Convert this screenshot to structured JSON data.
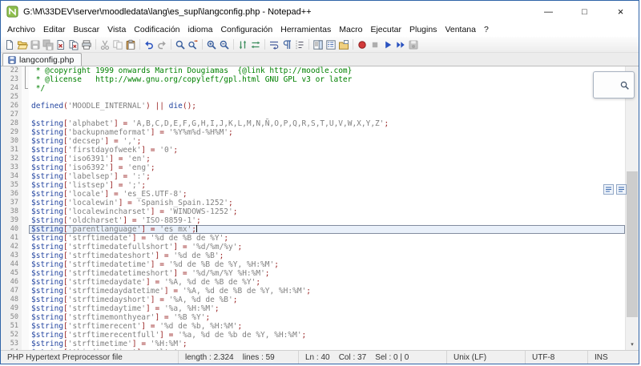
{
  "window": {
    "title": "G:\\M\\33DEV\\server\\moodledata\\lang\\es_supl\\langconfig.php - Notepad++",
    "controls": {
      "minimize": "—",
      "maximize": "□",
      "close": "×"
    }
  },
  "icons": {
    "scroll_up": "▴",
    "scroll_down": "▾"
  },
  "menu": {
    "items": [
      {
        "label": "Archivo",
        "name": "archivo"
      },
      {
        "label": "Editar",
        "name": "editar"
      },
      {
        "label": "Buscar",
        "name": "buscar"
      },
      {
        "label": "Vista",
        "name": "vista"
      },
      {
        "label": "Codificación",
        "name": "codificacion"
      },
      {
        "label": "idioma",
        "name": "idioma"
      },
      {
        "label": "Configuración",
        "name": "configuracion"
      },
      {
        "label": "Herramientas",
        "name": "herramientas"
      },
      {
        "label": "Macro",
        "name": "macro"
      },
      {
        "label": "Ejecutar",
        "name": "ejecutar"
      },
      {
        "label": "Plugins",
        "name": "plugins"
      },
      {
        "label": "Ventana",
        "name": "ventana"
      },
      {
        "label": "?",
        "name": "help"
      }
    ]
  },
  "toolbar": {
    "items": [
      {
        "name": "new-file",
        "icon": "new"
      },
      {
        "name": "open-file",
        "icon": "open"
      },
      {
        "name": "save-file",
        "icon": "save",
        "disabled": true
      },
      {
        "name": "save-all",
        "icon": "saveall",
        "disabled": true
      },
      {
        "name": "close-file",
        "icon": "close"
      },
      {
        "name": "close-all",
        "icon": "closeall"
      },
      {
        "name": "print",
        "icon": "print"
      },
      {
        "sep": true
      },
      {
        "name": "cut",
        "icon": "cut",
        "disabled": true
      },
      {
        "name": "copy",
        "icon": "copy",
        "disabled": true
      },
      {
        "name": "paste",
        "icon": "paste"
      },
      {
        "sep": true
      },
      {
        "name": "undo",
        "icon": "undo"
      },
      {
        "name": "redo",
        "icon": "redo",
        "disabled": true
      },
      {
        "sep": true
      },
      {
        "name": "find",
        "icon": "find"
      },
      {
        "name": "replace",
        "icon": "replace"
      },
      {
        "sep": true
      },
      {
        "name": "zoom-in",
        "icon": "zoomin"
      },
      {
        "name": "zoom-out",
        "icon": "zoomout"
      },
      {
        "sep": true
      },
      {
        "name": "sync-vertical-scroll",
        "icon": "syncv"
      },
      {
        "name": "sync-horizontal-scroll",
        "icon": "synch"
      },
      {
        "sep": true
      },
      {
        "name": "word-wrap",
        "icon": "wrap"
      },
      {
        "name": "show-all-characters",
        "icon": "para"
      },
      {
        "name": "indent-guide",
        "icon": "indent"
      },
      {
        "sep": true
      },
      {
        "name": "document-map",
        "icon": "docmap"
      },
      {
        "name": "function-list",
        "icon": "funclist"
      },
      {
        "name": "folder-as-workspace",
        "icon": "folderws"
      },
      {
        "sep": true
      },
      {
        "name": "record-macro",
        "icon": "record"
      },
      {
        "name": "stop-recording",
        "icon": "stop",
        "disabled": true
      },
      {
        "name": "playback-macro",
        "icon": "play"
      },
      {
        "name": "run-macro-multiple",
        "icon": "playall"
      },
      {
        "name": "save-recorded-macro",
        "icon": "savemacro",
        "disabled": true
      }
    ]
  },
  "tabbar": {
    "tabs": [
      {
        "label": "langconfig.php",
        "active": true,
        "saved": true
      }
    ]
  },
  "editor": {
    "language": "PHP",
    "first_visible_line": 22,
    "current_line": 40,
    "lines": [
      {
        "n": 22,
        "t": "c",
        "fold": "line",
        "text": " * @copyright 1999 onwards Martin Dougiamas  {@link http://moodle.com}"
      },
      {
        "n": 23,
        "t": "c",
        "fold": "line",
        "text": " * @license   http://www.gnu.org/copyleft/gpl.html GNU GPL v3 or later"
      },
      {
        "n": 24,
        "t": "c",
        "fold": "end",
        "text": " */"
      },
      {
        "n": 25,
        "t": "b"
      },
      {
        "n": 26,
        "t": "x",
        "tokens": [
          [
            "k",
            "defined"
          ],
          [
            "o",
            "("
          ],
          [
            "s",
            "'MOODLE_INTERNAL'"
          ],
          [
            "o",
            ")"
          ],
          [
            "d",
            " "
          ],
          [
            "o",
            "||"
          ],
          [
            "d",
            " "
          ],
          [
            "k",
            "die"
          ],
          [
            "o",
            "();"
          ]
        ]
      },
      {
        "n": 27,
        "t": "b"
      },
      {
        "n": 28,
        "t": "a",
        "key": "alphabet",
        "value": "A,B,C,D,E,F,G,H,I,J,K,L,M,N,Ñ,O,P,Q,R,S,T,U,V,W,X,Y,Z"
      },
      {
        "n": 29,
        "t": "a",
        "key": "backupnameformat",
        "value": "%Y%m%d-%H%M"
      },
      {
        "n": 30,
        "t": "a",
        "key": "decsep",
        "value": ","
      },
      {
        "n": 31,
        "t": "a",
        "key": "firstdayofweek",
        "value": "0"
      },
      {
        "n": 32,
        "t": "a",
        "key": "iso6391",
        "value": "en"
      },
      {
        "n": 33,
        "t": "a",
        "key": "iso6392",
        "value": "eng"
      },
      {
        "n": 34,
        "t": "a",
        "key": "labelsep",
        "value": ":"
      },
      {
        "n": 35,
        "t": "a",
        "key": "listsep",
        "value": ";"
      },
      {
        "n": 36,
        "t": "a",
        "key": "locale",
        "value": "es_ES.UTF-8"
      },
      {
        "n": 37,
        "t": "a",
        "key": "localewin",
        "value": "Spanish_Spain.1252"
      },
      {
        "n": 38,
        "t": "a",
        "key": "localewincharset",
        "value": "WINDOWS-1252"
      },
      {
        "n": 39,
        "t": "a",
        "key": "oldcharset",
        "value": "ISO-8859-1"
      },
      {
        "n": 40,
        "t": "a",
        "key": "parentlanguage",
        "value": "es_mx",
        "current": true
      },
      {
        "n": 41,
        "t": "a",
        "key": "strftimedate",
        "value": "%d de %B de %Y"
      },
      {
        "n": 42,
        "t": "a",
        "key": "strftimedatefullshort",
        "value": "%d/%m/%y"
      },
      {
        "n": 43,
        "t": "a",
        "key": "strftimedateshort",
        "value": "%d de %B"
      },
      {
        "n": 44,
        "t": "a",
        "key": "strftimedatetime",
        "value": "%d de %B de %Y, %H:%M"
      },
      {
        "n": 45,
        "t": "a",
        "key": "strftimedatetimeshort",
        "value": "%d/%m/%Y %H:%M"
      },
      {
        "n": 46,
        "t": "a",
        "key": "strftimedaydate",
        "value": "%A, %d de %B de %Y"
      },
      {
        "n": 47,
        "t": "a",
        "key": "strftimedaydatetime",
        "value": "%A, %d de %B de %Y, %H:%M"
      },
      {
        "n": 48,
        "t": "a",
        "key": "strftimedayshort",
        "value": "%A, %d de %B"
      },
      {
        "n": 49,
        "t": "a",
        "key": "strftimedaytime",
        "value": "%a, %H:%M"
      },
      {
        "n": 50,
        "t": "a",
        "key": "strftimemonthyear",
        "value": "%B %Y"
      },
      {
        "n": 51,
        "t": "a",
        "key": "strftimerecent",
        "value": "%d de %b, %H:%M"
      },
      {
        "n": 52,
        "t": "a",
        "key": "strftimerecentfull",
        "value": "%a, %d de %b de %Y, %H:%M"
      },
      {
        "n": 53,
        "t": "a",
        "key": "strftimetime",
        "value": "%H:%M"
      },
      {
        "n": 54,
        "t": "a",
        "key": "thisdirection",
        "value": "ltr"
      }
    ]
  },
  "statusbar": {
    "doc_type": "PHP Hypertext Preprocessor file",
    "length_lines": "length : 2.324    lines : 59",
    "position": "Ln : 40    Col : 37    Sel : 0 | 0",
    "eol": "Unix (LF)",
    "encoding": "UTF-8",
    "mode": "INS"
  },
  "colors": {
    "comment": "#008000",
    "string": "#808080",
    "variable": "#2345a0",
    "operator": "#992222",
    "current_line_background": "#e9f0fa",
    "window_border": "#2f64a8"
  }
}
